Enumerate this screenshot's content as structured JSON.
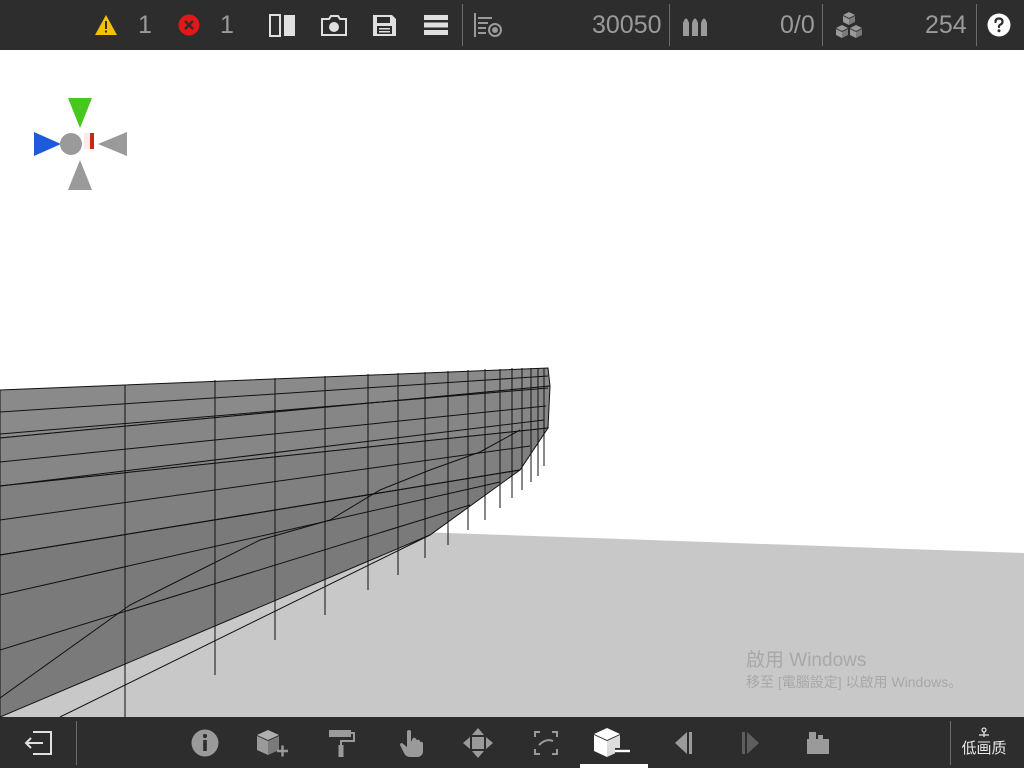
{
  "topbar": {
    "warnings_count": "1",
    "errors_count": "1",
    "polygon_count": "30050",
    "ammo_count": "0/0",
    "parts_count": "254"
  },
  "icons": {
    "warning": "warning-icon",
    "error": "error-icon",
    "split_view": "split-view-icon",
    "camera": "camera-icon",
    "save": "save-icon",
    "menu": "menu-icon",
    "stats": "stats-icon",
    "ammo": "ammo-icon",
    "parts": "parts-icon",
    "help": "help-icon"
  },
  "bottombar": {
    "quality_label": "低画质"
  },
  "watermark": {
    "line1": "啟用 Windows",
    "line2": "移至 [電腦設定] 以啟用 Windows。"
  },
  "colors": {
    "bar_bg": "#2d2d2d",
    "icon_gray": "#9a9a9a",
    "active_white": "#ffffff",
    "warning_yellow": "#f2c200",
    "error_red": "#e01818",
    "axis_green": "#46c81e",
    "axis_blue": "#1e5adc",
    "axis_red": "#c82814",
    "model_gray": "#808080",
    "ground_gray": "#c8c8c8"
  }
}
